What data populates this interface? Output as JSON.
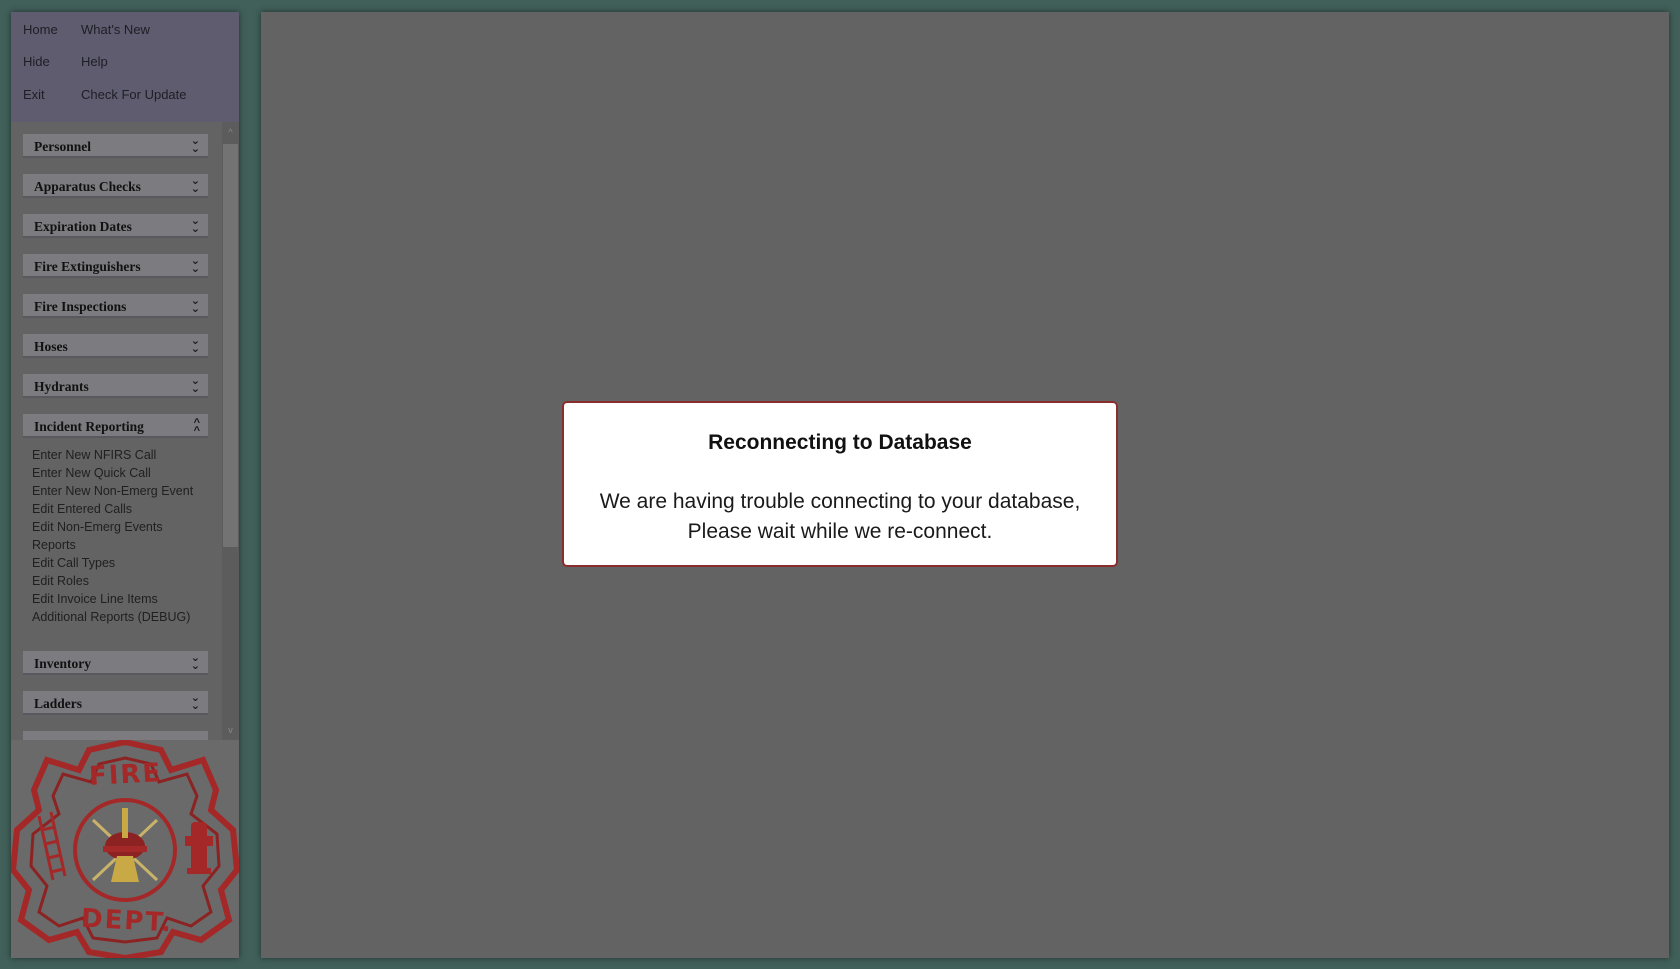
{
  "top_menu": {
    "home": "Home",
    "whats_new": "What's New",
    "hide": "Hide",
    "help": "Help",
    "exit": "Exit",
    "check_update": "Check For Update"
  },
  "sections": [
    {
      "label": "Personnel",
      "state": "collapsed"
    },
    {
      "label": "Apparatus Checks",
      "state": "collapsed"
    },
    {
      "label": "Expiration Dates",
      "state": "collapsed"
    },
    {
      "label": "Fire Extinguishers",
      "state": "collapsed"
    },
    {
      "label": "Fire Inspections",
      "state": "collapsed"
    },
    {
      "label": "Hoses",
      "state": "collapsed"
    },
    {
      "label": "Hydrants",
      "state": "collapsed"
    },
    {
      "label": "Incident Reporting",
      "state": "expanded"
    },
    {
      "label": "Inventory",
      "state": "collapsed"
    },
    {
      "label": "Ladders",
      "state": "collapsed"
    }
  ],
  "incident_items": [
    "Enter New NFIRS Call",
    "Enter New Quick Call",
    "Enter New Non-Emerg Event",
    "Edit Entered Calls",
    "Edit Non-Emerg Events",
    "Reports",
    "Edit Call Types",
    "Edit Roles",
    "Edit Invoice Line Items",
    "Additional Reports (DEBUG)"
  ],
  "logo": {
    "top_text": "FIRE",
    "bottom_text": "DEPT.",
    "color": "#a52828"
  },
  "dialog": {
    "title": "Reconnecting to Database",
    "line1": "We are having trouble connecting to your database,",
    "line2": "Please wait while we re-connect."
  },
  "colors": {
    "background": "#41605a",
    "overlay": "#636363",
    "dialog_border": "#8b2d2d"
  }
}
